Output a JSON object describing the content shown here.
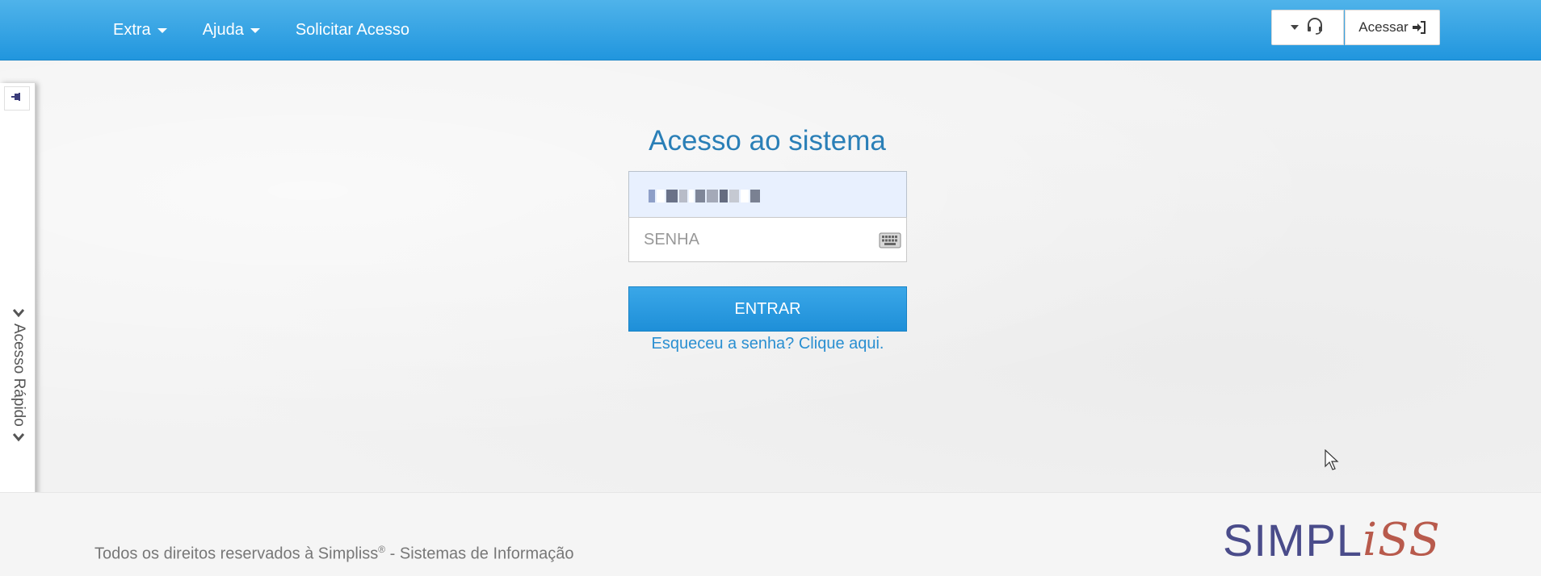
{
  "nav": {
    "items": [
      {
        "label": "Extra",
        "has_dropdown": true
      },
      {
        "label": "Ajuda",
        "has_dropdown": true
      },
      {
        "label": "Solicitar Acesso",
        "has_dropdown": false
      }
    ],
    "support_icon": "headset-icon",
    "login_label": "Acessar",
    "login_icon": "sign-in-icon"
  },
  "quick_access": {
    "label": "Acesso Rápido",
    "pin_icon": "pin-icon"
  },
  "login": {
    "title": "Acesso ao sistema",
    "password_placeholder": "SENHA",
    "keyboard_icon": "keyboard-icon",
    "submit_label": "ENTRAR",
    "forgot_link": "Esqueceu a senha? Clique aqui."
  },
  "footer": {
    "copyright_prefix": "Todos os direitos reservados à Simpliss",
    "registered_mark": "®",
    "copyright_suffix": " - Sistemas de Informação",
    "logo_part1": "SIMPL",
    "logo_part2": "iSS"
  },
  "colors": {
    "navbar": "#2196de",
    "title": "#2a7fb7",
    "link": "#2a8fd1",
    "button": "#1e8fd8",
    "logo_primary": "#4a4c8a",
    "logo_accent": "#b85a4c"
  }
}
